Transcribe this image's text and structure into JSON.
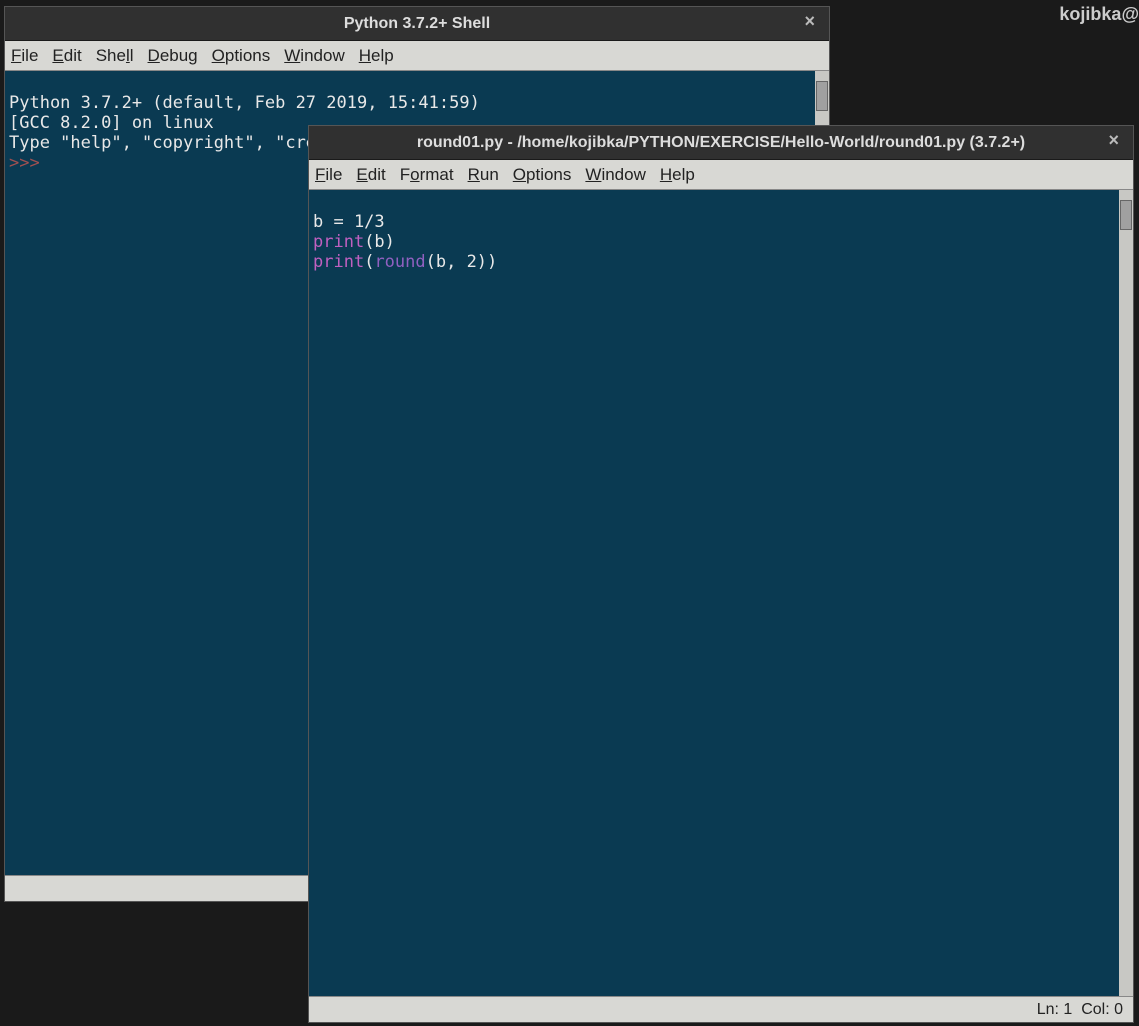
{
  "desktop": {
    "header_text": "kojibka@"
  },
  "shell_window": {
    "title": "Python 3.7.2+ Shell",
    "menu": [
      "File",
      "Edit",
      "Shell",
      "Debug",
      "Options",
      "Window",
      "Help"
    ],
    "lines": {
      "l1": "Python 3.7.2+ (default, Feb 27 2019, 15:41:59) ",
      "l2": "[GCC 8.2.0] on linux",
      "l3": "Type \"help\", \"copyright\", \"cre",
      "prompt": ">>> "
    }
  },
  "editor_window": {
    "title": "round01.py - /home/kojibka/PYTHON/EXERCISE/Hello-World/round01.py (3.7.2+)",
    "menu": [
      "File",
      "Edit",
      "Format",
      "Run",
      "Options",
      "Window",
      "Help"
    ],
    "code": {
      "l1": "b = 1/3",
      "l2a": "print",
      "l2b": "(b)",
      "l3a": "print",
      "l3b": "(",
      "l3c": "round",
      "l3d": "(b, 2))"
    },
    "status": {
      "ln_label": "Ln:",
      "ln": "1",
      "col_label": "Col:",
      "col": "0"
    }
  }
}
